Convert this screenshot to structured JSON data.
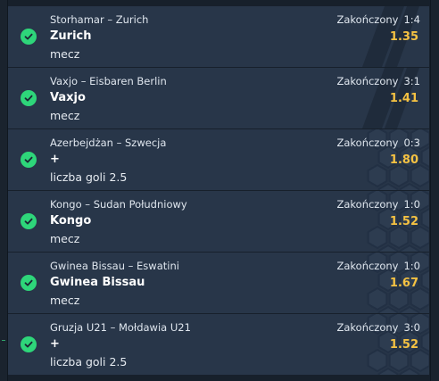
{
  "colors": {
    "check": "#2ed67a",
    "odds": "#f5c242",
    "card_bg": "#283649",
    "page_bg": "#17202b"
  },
  "icons": {
    "status_icon": "check-circle-icon"
  },
  "bets": [
    {
      "match": "Storhamar – Zurich",
      "status": "Zakończony",
      "score": "1:4",
      "pick": "Zurich",
      "odds": "1.35",
      "market": "mecz",
      "decoration": "stripes"
    },
    {
      "match": "Vaxjo – Eisbaren Berlin",
      "status": "Zakończony",
      "score": "3:1",
      "pick": "Vaxjo",
      "odds": "1.41",
      "market": "mecz",
      "decoration": "stripes"
    },
    {
      "match": "Azerbejdżan – Szwecja",
      "status": "Zakończony",
      "score": "0:3",
      "pick": "+",
      "odds": "1.80",
      "market": "liczba goli 2.5",
      "decoration": "hex"
    },
    {
      "match": "Kongo – Sudan Południowy",
      "status": "Zakończony",
      "score": "1:0",
      "pick": "Kongo",
      "odds": "1.52",
      "market": "mecz",
      "decoration": "hex"
    },
    {
      "match": "Gwinea Bissau – Eswatini",
      "status": "Zakończony",
      "score": "1:0",
      "pick": "Gwinea Bissau",
      "odds": "1.67",
      "market": "mecz",
      "decoration": "hex"
    },
    {
      "match": "Gruzja U21 – Mołdawia U21",
      "status": "Zakończony",
      "score": "3:0",
      "pick": "+",
      "odds": "1.52",
      "market": "liczba goli 2.5",
      "decoration": "hex"
    }
  ]
}
